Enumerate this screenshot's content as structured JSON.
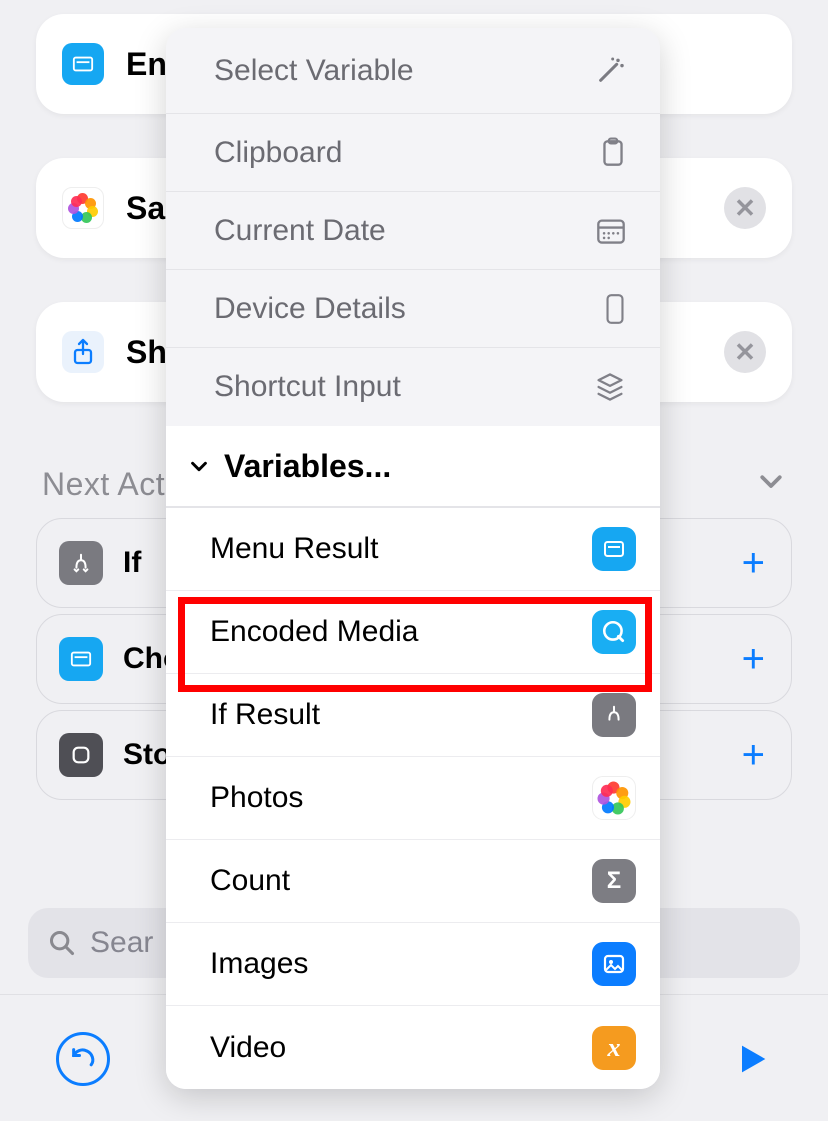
{
  "background": {
    "cards": [
      {
        "title_partial": "En"
      },
      {
        "title_partial": "Sa"
      },
      {
        "title_partial": "Sha"
      }
    ],
    "section_label": "Next Act",
    "pills": [
      {
        "label": "If"
      },
      {
        "label": "Cho"
      },
      {
        "label": "Sto"
      }
    ],
    "search_placeholder": "Sear"
  },
  "popup": {
    "system_rows": [
      {
        "label": "Select Variable",
        "icon": "magic-wand-icon"
      },
      {
        "label": "Clipboard",
        "icon": "clipboard-icon"
      },
      {
        "label": "Current Date",
        "icon": "calendar-icon"
      },
      {
        "label": "Device Details",
        "icon": "device-icon"
      },
      {
        "label": "Shortcut Input",
        "icon": "layers-icon"
      }
    ],
    "section_header": "Variables...",
    "variable_rows": [
      {
        "label": "Menu Result",
        "icon_bg": "#16a7f2",
        "icon": "menu-result-icon"
      },
      {
        "label": "Encoded Media",
        "icon_bg": "#19aef3",
        "icon": "quicktime-icon",
        "highlighted": true
      },
      {
        "label": "If Result",
        "icon_bg": "#7a7a80",
        "icon": "branch-icon"
      },
      {
        "label": "Photos",
        "icon_bg": "#ffffff",
        "icon": "photos-flower-icon"
      },
      {
        "label": "Count",
        "icon_bg": "#7d7d83",
        "icon": "sigma-icon"
      },
      {
        "label": "Images",
        "icon_bg": "#0b7dff",
        "icon": "image-icon"
      },
      {
        "label": "Video",
        "icon_bg": "#f59b1f",
        "icon": "x-variable-icon"
      }
    ]
  }
}
